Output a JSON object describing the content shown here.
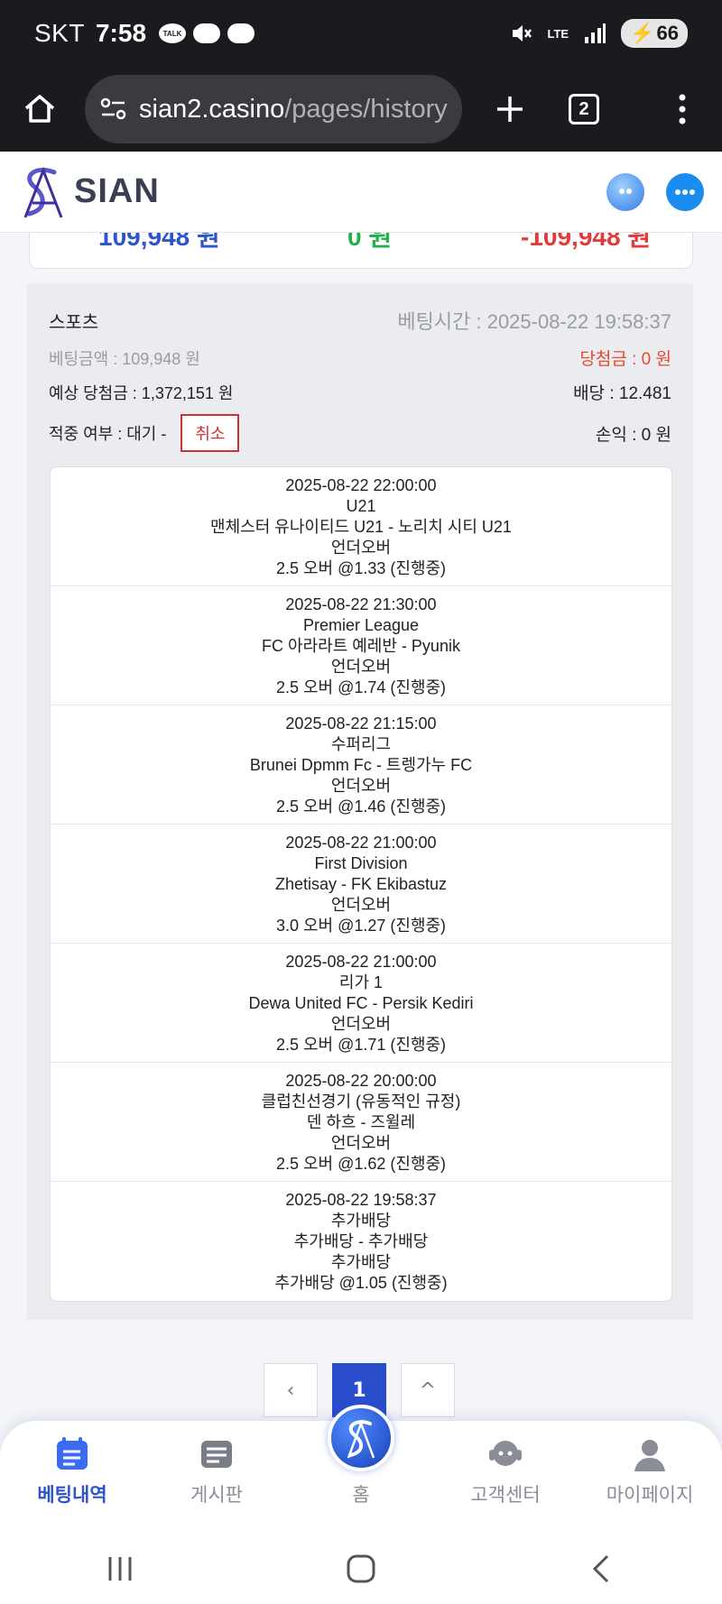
{
  "status_bar": {
    "carrier": "SKT",
    "time": "7:58",
    "talk_label": "TALK",
    "network": "LTE",
    "battery": "66"
  },
  "browser": {
    "url_host": "sian2.casino",
    "url_path": "/pages/history",
    "tab_count": "2"
  },
  "site": {
    "logo_text": "SIAN"
  },
  "summary": {
    "bet_total": "109,948 원",
    "win_total": "0 원",
    "profit_total": "-109,948 원"
  },
  "bet": {
    "category": "스포츠",
    "bet_time": "베팅시간 : 2025-08-22 19:58:37",
    "bet_amount": "베팅금액 : 109,948 원",
    "win_amount": "당첨금 : 0 원",
    "expected_win": "예상 당첨금 : 1,372,151 원",
    "odds": "배당 : 12.481",
    "hit_status": "적중 여부 : 대기 -",
    "cancel_label": "취소",
    "profit": "손익 : 0 원",
    "games": [
      {
        "datetime": "2025-08-22 22:00:00",
        "league": "U21",
        "match": "맨체스터 유나이티드 U21 - 노리치 시티 U21",
        "market": "언더오버",
        "pick": "2.5 오버 @1.33 (진행중)"
      },
      {
        "datetime": "2025-08-22 21:30:00",
        "league": "Premier League",
        "match": "FC 아라라트 예레반 - Pyunik",
        "market": "언더오버",
        "pick": "2.5 오버 @1.74 (진행중)"
      },
      {
        "datetime": "2025-08-22 21:15:00",
        "league": "수퍼리그",
        "match": "Brunei Dpmm Fc - 트렝가누 FC",
        "market": "언더오버",
        "pick": "2.5 오버 @1.46 (진행중)"
      },
      {
        "datetime": "2025-08-22 21:00:00",
        "league": "First Division",
        "match": "Zhetisay - FK Ekibastuz",
        "market": "언더오버",
        "pick": "3.0 오버 @1.27 (진행중)"
      },
      {
        "datetime": "2025-08-22 21:00:00",
        "league": "리가 1",
        "match": "Dewa United FC - Persik Kediri",
        "market": "언더오버",
        "pick": "2.5 오버 @1.71 (진행중)"
      },
      {
        "datetime": "2025-08-22 20:00:00",
        "league": "클럽친선경기 (유동적인 규정)",
        "match": "덴 하흐 - 즈윌레",
        "market": "언더오버",
        "pick": "2.5 오버 @1.62 (진행중)"
      },
      {
        "datetime": "2025-08-22 19:58:37",
        "league": "추가배당",
        "match": "추가배당 - 추가배당",
        "market": "추가배당",
        "pick": "추가배당 @1.05 (진행중)"
      }
    ]
  },
  "pagination": {
    "prev": "‹",
    "current": "1",
    "next": "^"
  },
  "bottom_nav": {
    "items": [
      {
        "label": "베팅내역"
      },
      {
        "label": "게시판"
      },
      {
        "label": "홈"
      },
      {
        "label": "고객센터"
      },
      {
        "label": "마이페이지"
      }
    ]
  },
  "colors": {
    "accent": "#2c55c9",
    "win": "#22b14c",
    "loss": "#e03c3c",
    "cancel": "#d62d2d"
  }
}
